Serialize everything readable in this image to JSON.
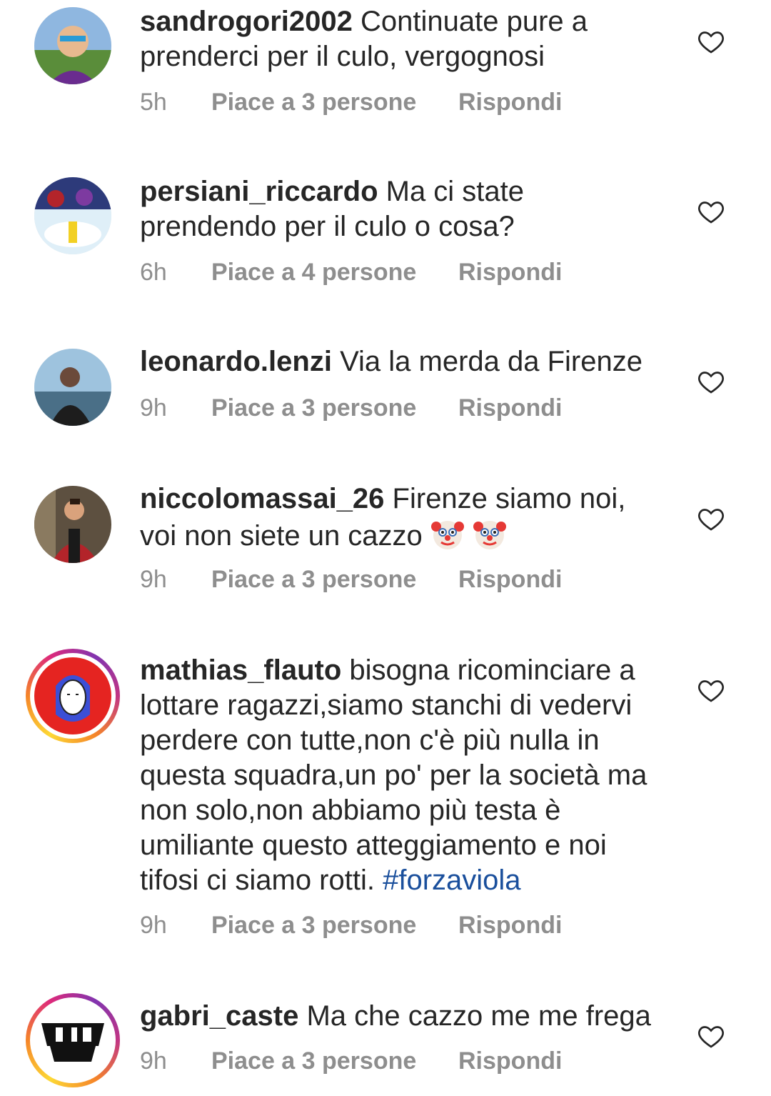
{
  "comments": [
    {
      "username": "sandrogori2002",
      "text": "Continuate pure a prenderci per il culo, vergognosi",
      "time": "5h",
      "likes": "Piace a 3 persone",
      "reply": "Rispondi"
    },
    {
      "username": "persiani_riccardo",
      "text": "Ma ci state prendendo per il culo o cosa?",
      "time": "6h",
      "likes": "Piace a 4 persone",
      "reply": "Rispondi"
    },
    {
      "username": "leonardo.lenzi",
      "text": "Via la merda da Firenze",
      "time": "9h",
      "likes": "Piace a 3 persone",
      "reply": "Rispondi"
    },
    {
      "username": "niccolomassai_26",
      "text": "Firenze siamo noi, voi non siete un cazzo",
      "time": "9h",
      "likes": "Piace a 3 persone",
      "reply": "Rispondi"
    },
    {
      "username": "mathias_flauto",
      "text": "bisogna ricominciare a lottare ragazzi,siamo stanchi di vedervi perdere con tutte,non c'è più nulla in questa squadra,un po' per la società ma non solo,non abbiamo più testa è umiliante questo atteggiamento e noi tifosi ci siamo rotti.",
      "hashtag": "#forzaviola",
      "time": "9h",
      "likes": "Piace a 3 persone",
      "reply": "Rispondi"
    },
    {
      "username": "gabri_caste",
      "text": "Ma che cazzo me me frega",
      "time": "9h",
      "likes": "Piace a 3 persone",
      "reply": "Rispondi"
    }
  ],
  "icons": {
    "like": "heart-outline-icon",
    "emoji": "clown-face-emoji"
  },
  "colors": {
    "text": "#262626",
    "meta": "#8e8e8e",
    "hashtag": "#1a4f9c"
  }
}
